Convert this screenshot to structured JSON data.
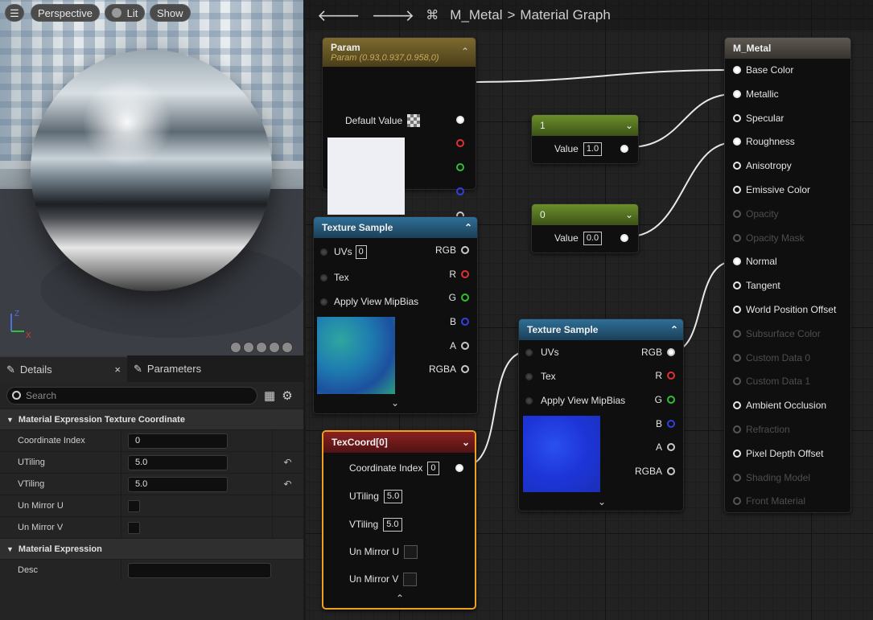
{
  "viewport": {
    "menu_icon": "hamburger-icon",
    "perspective_label": "Perspective",
    "lit_label": "Lit",
    "show_label": "Show",
    "axis_z": "Z",
    "axis_x": "X"
  },
  "details": {
    "tab_details": "Details",
    "tab_parameters": "Parameters",
    "close": "×",
    "search_placeholder": "Search",
    "section1": "Material Expression Texture Coordinate",
    "section2": "Material Expression",
    "rows": [
      {
        "name": "Coordinate Index",
        "value": "0"
      },
      {
        "name": "UTiling",
        "value": "5.0"
      },
      {
        "name": "VTiling",
        "value": "5.0"
      },
      {
        "name": "Un Mirror U",
        "value": ""
      },
      {
        "name": "Un Mirror V",
        "value": ""
      },
      {
        "name": "Desc",
        "value": ""
      }
    ]
  },
  "graph": {
    "breadcrumb_root": "M_Metal",
    "breadcrumb_sep": ">",
    "breadcrumb_page": "Material Graph",
    "param_node": {
      "title": "Param",
      "subtitle": "Param (0.93,0.937,0.958,0)",
      "default_value_label": "Default Value"
    },
    "const1": {
      "title": "1",
      "value_label": "Value",
      "value": "1.0"
    },
    "const0": {
      "title": "0",
      "value_label": "Value",
      "value": "0.0"
    },
    "tex_sample_1": {
      "title": "Texture Sample",
      "uvs_label": "UVs",
      "uvs_value": "0",
      "tex_label": "Tex",
      "mipbias_label": "Apply View MipBias",
      "outputs": [
        "RGB",
        "R",
        "G",
        "B",
        "A",
        "RGBA"
      ]
    },
    "tex_sample_2": {
      "title": "Texture Sample",
      "uvs_label": "UVs",
      "tex_label": "Tex",
      "mipbias_label": "Apply View MipBias",
      "outputs": [
        "RGB",
        "R",
        "G",
        "B",
        "A",
        "RGBA"
      ]
    },
    "texcoord": {
      "title": "TexCoord[0]",
      "coord_label": "Coordinate Index",
      "coord_value": "0",
      "utiling_label": "UTiling",
      "utiling_value": "5.0",
      "vtiling_label": "VTiling",
      "vtiling_value": "5.0",
      "unmirror_u_label": "Un Mirror U",
      "unmirror_v_label": "Un Mirror V"
    },
    "result_node": {
      "title": "M_Metal",
      "inputs": [
        {
          "label": "Base Color",
          "enabled": true,
          "connected": true
        },
        {
          "label": "Metallic",
          "enabled": true,
          "connected": true
        },
        {
          "label": "Specular",
          "enabled": true,
          "connected": false
        },
        {
          "label": "Roughness",
          "enabled": true,
          "connected": true
        },
        {
          "label": "Anisotropy",
          "enabled": true,
          "connected": false
        },
        {
          "label": "Emissive Color",
          "enabled": true,
          "connected": false
        },
        {
          "label": "Opacity",
          "enabled": false,
          "connected": false
        },
        {
          "label": "Opacity Mask",
          "enabled": false,
          "connected": false
        },
        {
          "label": "Normal",
          "enabled": true,
          "connected": true
        },
        {
          "label": "Tangent",
          "enabled": true,
          "connected": false
        },
        {
          "label": "World Position Offset",
          "enabled": true,
          "connected": false
        },
        {
          "label": "Subsurface Color",
          "enabled": false,
          "connected": false
        },
        {
          "label": "Custom Data 0",
          "enabled": false,
          "connected": false
        },
        {
          "label": "Custom Data 1",
          "enabled": false,
          "connected": false
        },
        {
          "label": "Ambient Occlusion",
          "enabled": true,
          "connected": false
        },
        {
          "label": "Refraction",
          "enabled": false,
          "connected": false
        },
        {
          "label": "Pixel Depth Offset",
          "enabled": true,
          "connected": false
        },
        {
          "label": "Shading Model",
          "enabled": false,
          "connected": false
        },
        {
          "label": "Front Material",
          "enabled": false,
          "connected": false
        }
      ]
    }
  },
  "colors": {
    "texture_header": "#2f6f97",
    "param_header": "#7d6a2f",
    "constant_header": "#6b8e2a",
    "texcoord_header": "#8a2020",
    "selection": "#f0a020",
    "pin_red": "#e03030",
    "pin_green": "#30c030",
    "pin_blue": "#3040e0"
  }
}
